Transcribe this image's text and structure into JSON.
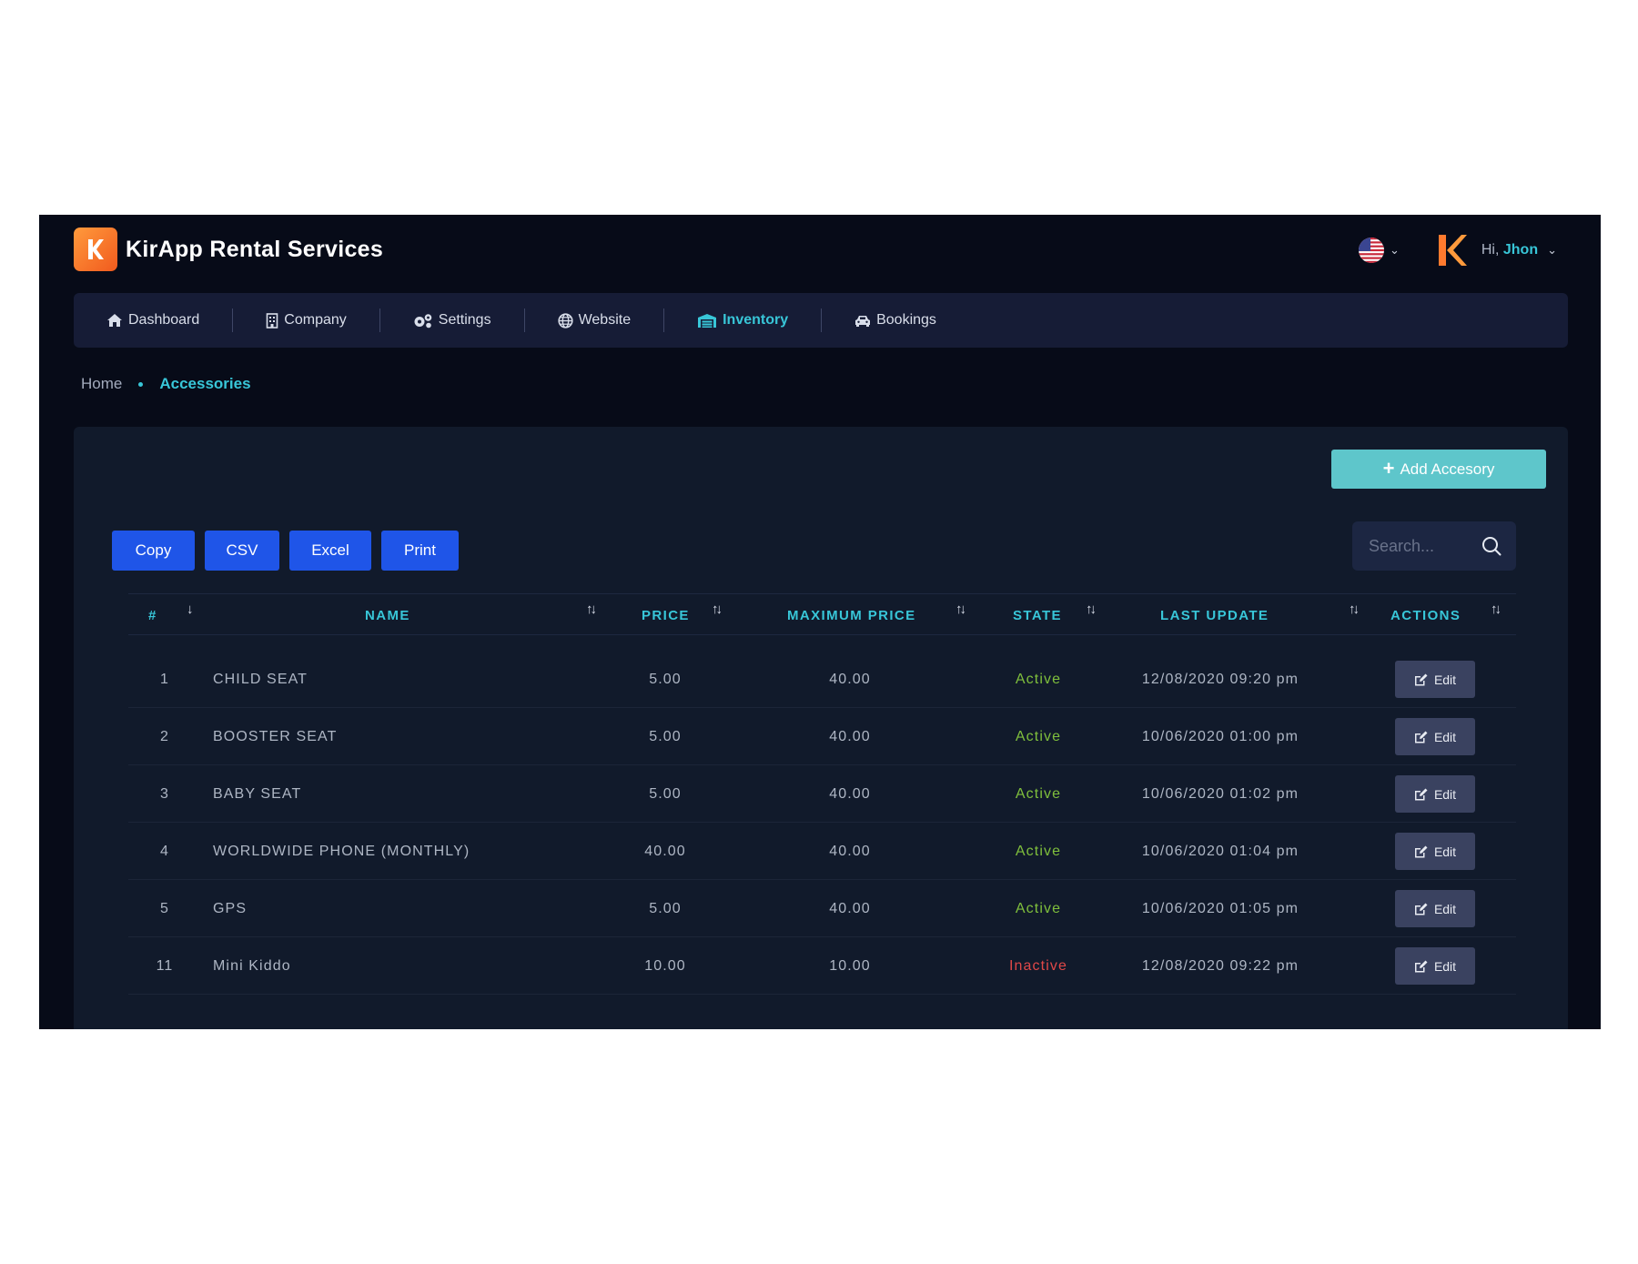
{
  "header": {
    "brand_title": "KirApp Rental Services",
    "greeting_prefix": "Hi,",
    "user_name": "Jhon"
  },
  "nav": {
    "items": [
      {
        "label": "Dashboard",
        "icon": "home-icon"
      },
      {
        "label": "Company",
        "icon": "building-icon"
      },
      {
        "label": "Settings",
        "icon": "gears-icon"
      },
      {
        "label": "Website",
        "icon": "globe-icon"
      },
      {
        "label": "Inventory",
        "icon": "warehouse-icon",
        "active": true
      },
      {
        "label": "Bookings",
        "icon": "car-icon"
      }
    ]
  },
  "breadcrumb": {
    "home": "Home",
    "current": "Accessories"
  },
  "toolbar": {
    "add_label": "Add Accesory",
    "copy_label": "Copy",
    "csv_label": "CSV",
    "excel_label": "Excel",
    "print_label": "Print",
    "search_placeholder": "Search..."
  },
  "table": {
    "columns": [
      "#",
      "NAME",
      "PRICE",
      "MAXIMUM PRICE",
      "STATE",
      "LAST UPDATE",
      "ACTIONS"
    ],
    "edit_label": "Edit",
    "rows": [
      {
        "id": "1",
        "name": "CHILD SEAT",
        "price": "5.00",
        "max_price": "40.00",
        "state": "Active",
        "last_update": "12/08/2020 09:20 pm"
      },
      {
        "id": "2",
        "name": "BOOSTER SEAT",
        "price": "5.00",
        "max_price": "40.00",
        "state": "Active",
        "last_update": "10/06/2020 01:00 pm"
      },
      {
        "id": "3",
        "name": "BABY SEAT",
        "price": "5.00",
        "max_price": "40.00",
        "state": "Active",
        "last_update": "10/06/2020 01:02 pm"
      },
      {
        "id": "4",
        "name": "WORLDWIDE PHONE (MONTHLY)",
        "price": "40.00",
        "max_price": "40.00",
        "state": "Active",
        "last_update": "10/06/2020 01:04 pm"
      },
      {
        "id": "5",
        "name": "GPS",
        "price": "5.00",
        "max_price": "40.00",
        "state": "Active",
        "last_update": "10/06/2020 01:05 pm"
      },
      {
        "id": "11",
        "name": "Mini Kiddo",
        "price": "10.00",
        "max_price": "10.00",
        "state": "Inactive",
        "last_update": "12/08/2020 09:22 pm"
      }
    ]
  },
  "colors": {
    "accent": "#38c6d8",
    "export_button": "#1f55e8",
    "add_button": "#5ec6cb",
    "active_state": "#7fbf3c",
    "inactive_state": "#e04848"
  }
}
